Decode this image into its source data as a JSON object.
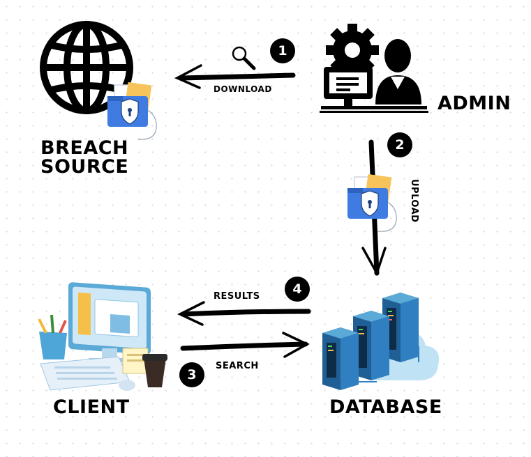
{
  "nodes": {
    "breach_source": "BREACH\nSOURCE",
    "admin": "ADMIN",
    "client": "CLIENT",
    "database": "DATABASE"
  },
  "edges": {
    "download": "DOWNLOAD",
    "upload": "UPLOAD",
    "results": "RESULTS",
    "search": "SEARCH"
  },
  "steps": [
    "1",
    "2",
    "3",
    "4"
  ],
  "icons": {
    "globe": "globe-icon",
    "admin": "admin-computer-icon",
    "folder": "secure-folder-icon",
    "magnifier": "magnifier-icon",
    "client": "desktop-computer-icon",
    "database": "server-rack-icon"
  },
  "colors": {
    "ink": "#000000",
    "folder_blue": "#3f7be0",
    "folder_yellow": "#f6c45a",
    "server_blue": "#2f7fc1",
    "cloud": "#bfe3f5"
  }
}
